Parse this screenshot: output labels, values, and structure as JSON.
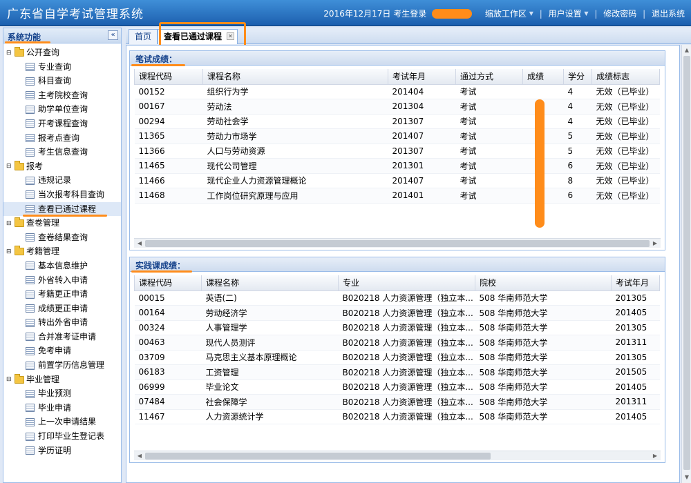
{
  "header": {
    "title": "广东省自学考试管理系统",
    "date_text": "2016年12月17日 考生登录",
    "menu": [
      "缩放工作区",
      "用户设置",
      "修改密码",
      "退出系统"
    ]
  },
  "sidebar": {
    "title": "系统功能",
    "collapse_glyph": "«",
    "groups": [
      {
        "label": "公开查询",
        "items": [
          "专业查询",
          "科目查询",
          "主考院校查询",
          "助学单位查询",
          "开考课程查询",
          "报考点查询",
          "考生信息查询"
        ]
      },
      {
        "label": "报考",
        "items": [
          "违规记录",
          "当次报考科目查询",
          "查看已通过课程"
        ]
      },
      {
        "label": "查卷管理",
        "items": [
          "查卷结果查询"
        ]
      },
      {
        "label": "考籍管理",
        "items": [
          "基本信息维护",
          "外省转入申请",
          "考籍更正申请",
          "成绩更正申请",
          "转出外省申请",
          "合并准考证申请",
          "免考申请",
          "前置学历信息管理"
        ]
      },
      {
        "label": "毕业管理",
        "items": [
          "毕业预测",
          "毕业申请",
          "上一次申请结果",
          "打印毕业生登记表",
          "学历证明"
        ]
      }
    ]
  },
  "tabs": {
    "home": "首页",
    "active": "查看已通过课程",
    "close_glyph": "✕"
  },
  "written": {
    "title": "笔试成绩：",
    "columns": [
      "课程代码",
      "课程名称",
      "考试年月",
      "通过方式",
      "成绩",
      "学分",
      "成绩标志"
    ],
    "rows": [
      [
        "00152",
        "组织行为学",
        "201404",
        "考试",
        "",
        "4",
        "无效（已毕业）"
      ],
      [
        "00167",
        "劳动法",
        "201304",
        "考试",
        "",
        "4",
        "无效（已毕业）"
      ],
      [
        "00294",
        "劳动社会学",
        "201307",
        "考试",
        "",
        "4",
        "无效（已毕业）"
      ],
      [
        "11365",
        "劳动力市场学",
        "201407",
        "考试",
        "",
        "5",
        "无效（已毕业）"
      ],
      [
        "11366",
        "人口与劳动资源",
        "201307",
        "考试",
        "",
        "5",
        "无效（已毕业）"
      ],
      [
        "11465",
        "现代公司管理",
        "201301",
        "考试",
        "",
        "6",
        "无效（已毕业）"
      ],
      [
        "11466",
        "现代企业人力资源管理概论",
        "201407",
        "考试",
        "",
        "8",
        "无效（已毕业）"
      ],
      [
        "11468",
        "工作岗位研究原理与应用",
        "201401",
        "考试",
        "",
        "6",
        "无效（已毕业）"
      ]
    ]
  },
  "practice": {
    "title": "实践课成绩：",
    "columns": [
      "课程代码",
      "课程名称",
      "专业",
      "院校",
      "考试年月"
    ],
    "rows": [
      [
        "00015",
        "英语(二)",
        "B020218 人力资源管理（独立本...",
        "508 华南师范大学",
        "201305"
      ],
      [
        "00164",
        "劳动经济学",
        "B020218 人力资源管理（独立本...",
        "508 华南师范大学",
        "201405"
      ],
      [
        "00324",
        "人事管理学",
        "B020218 人力资源管理（独立本...",
        "508 华南师范大学",
        "201305"
      ],
      [
        "00463",
        "现代人员测评",
        "B020218 人力资源管理（独立本...",
        "508 华南师范大学",
        "201311"
      ],
      [
        "03709",
        "马克思主义基本原理概论",
        "B020218 人力资源管理（独立本...",
        "508 华南师范大学",
        "201305"
      ],
      [
        "06183",
        "工资管理",
        "B020218 人力资源管理（独立本...",
        "508 华南师范大学",
        "201505"
      ],
      [
        "06999",
        "毕业论文",
        "B020218 人力资源管理（独立本...",
        "508 华南师范大学",
        "201405"
      ],
      [
        "07484",
        "社会保障学",
        "B020218 人力资源管理（独立本...",
        "508 华南师范大学",
        "201311"
      ],
      [
        "11467",
        "人力资源统计学",
        "B020218 人力资源管理（独立本...",
        "508 华南师范大学",
        "201405"
      ]
    ]
  },
  "colors": {
    "header": "#1c5fae",
    "highlight": "#ff8c1a",
    "panel_title": "#15428b"
  }
}
